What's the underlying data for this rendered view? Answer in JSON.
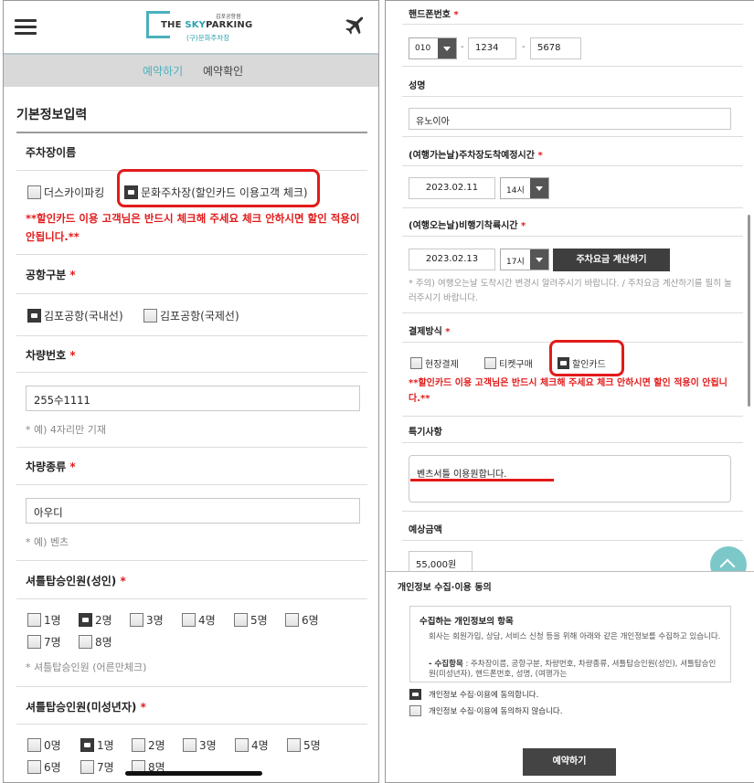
{
  "left": {
    "header": {
      "logo_top": "김포공항점",
      "logo_brand_prefix": "THE ",
      "logo_brand_sky": "SKY",
      "logo_brand_suffix": "PARKING",
      "logo_sub": "(구)문화주차장"
    },
    "tabs": {
      "reserve": "예약하기",
      "confirm": "예약확인"
    },
    "section_title": "기본정보입력",
    "parking_name": {
      "label": "주차장이름",
      "options": [
        {
          "label": "더스카이파킹",
          "checked": false
        },
        {
          "label": "문화주차장(할인카드 이용고객 체크)",
          "checked": true
        }
      ],
      "warning": "**할인카드 이용 고객님은 반드시 체크해 주세요 체크 안하시면 할인 적용이 안됩니다.**"
    },
    "airport": {
      "label": "공항구분",
      "required": "*",
      "options": [
        {
          "label": "김포공항(국내선)",
          "checked": true
        },
        {
          "label": "김포공항(국제선)",
          "checked": false
        }
      ]
    },
    "car_number": {
      "label": "차량번호",
      "required": "*",
      "value": "255수1111",
      "hint": "* 예) 4자리만 기재"
    },
    "car_type": {
      "label": "차량종류",
      "required": "*",
      "value": "아우디",
      "hint": "* 예) 벤츠"
    },
    "shuttle_adult": {
      "label": "셔틀탑승인원(성인)",
      "required": "*",
      "options": [
        "1명",
        "2명",
        "3명",
        "4명",
        "5명",
        "6명",
        "7명",
        "8명"
      ],
      "checked_index": 1,
      "hint": "* 셔틀탑승인원 (어른만체크)"
    },
    "shuttle_minor": {
      "label": "셔틀탑승인원(미성년자)",
      "required": "*",
      "options": [
        "0명",
        "1명",
        "2명",
        "3명",
        "4명",
        "5명",
        "6명",
        "7명",
        "8명"
      ],
      "checked_index": 1
    }
  },
  "right": {
    "phone": {
      "label": "핸드폰번호",
      "required": "*",
      "prefix": "010",
      "mid": "1234",
      "last": "5678",
      "sep": "-"
    },
    "name": {
      "label": "성명",
      "value": "유노이아"
    },
    "arrival": {
      "label": "(여행가는날)주차장도착예정시간",
      "required": "*",
      "date": "2023.02.11",
      "hour": "14시"
    },
    "return": {
      "label": "(여행오는날)비행기착륙시간",
      "required": "*",
      "date": "2023.02.13",
      "hour": "17시",
      "calc_button": "주차요금 계산하기",
      "hint": "* 주의) 여행오는날 도착시간 변경시 알려주시기 바랍니다. / 주차요금 계산하기를 필히 눌러주시기 바랍니다."
    },
    "payment": {
      "label": "결제방식",
      "required": "*",
      "options": [
        {
          "label": "현장결제",
          "checked": false
        },
        {
          "label": "티켓구매",
          "checked": false
        },
        {
          "label": "할인카드",
          "checked": true
        }
      ],
      "warning": "**할인카드 이용 고객님은 반드시 체크해 주세요 체크 안하시면 할인 적용이 안됩니다.**"
    },
    "notes": {
      "label": "특기사항",
      "value": "벤츠서틀 이용원합니다."
    },
    "estimate": {
      "label": "예상금액",
      "value": "55,000원"
    },
    "consent": {
      "title": "개인정보 수집·이용 동의",
      "box_heading": "수집하는 개인정보의 항목",
      "box_text": "회사는 회원가입, 상담, 서비스 신청 등을 위해 아래와 같은 개인정보를 수집하고 있습니다.",
      "box_items_label": "- 수집항목",
      "box_items": " : 주차장이름, 공항구분, 차량번호, 차량종류, 셔틀탑승인원(성인), 셔틀탑승인원(미성년자), 핸드폰번호, 성명, (여행가는",
      "agree": "개인정보 수집·이용에 동의합니다.",
      "disagree": "개인정보 수집·이용에 동의하지 않습니다.",
      "agree_checked": true,
      "submit": "예약하기"
    }
  },
  "colors": {
    "accent": "#4bb0bd",
    "warning": "#e11b1b",
    "highlight": "#e31a1a",
    "button": "#3e3e3e"
  }
}
